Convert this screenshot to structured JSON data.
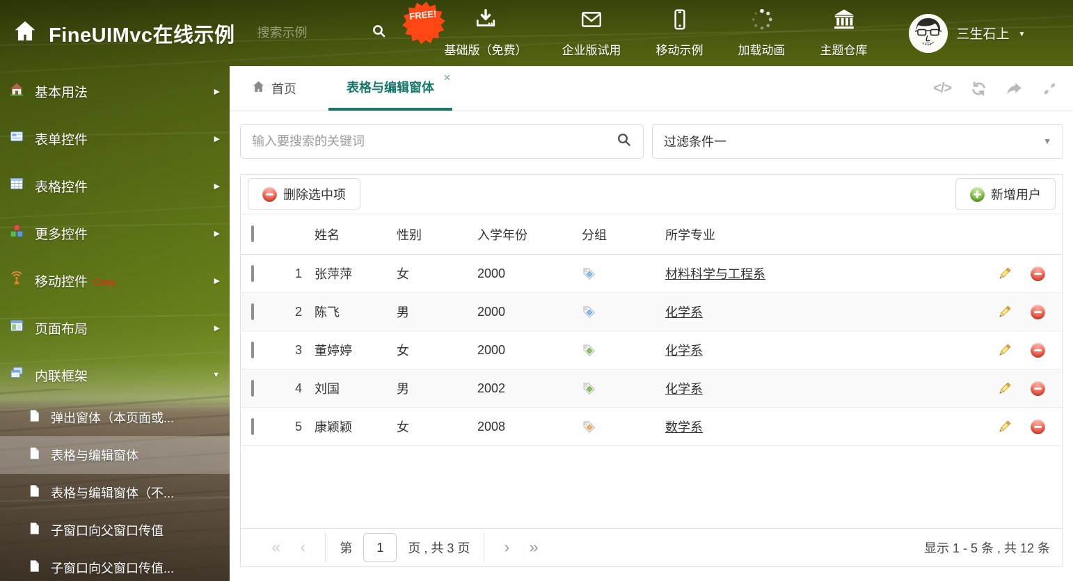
{
  "header": {
    "logo": "FineUIMvc在线示例",
    "search_placeholder": "搜索示例",
    "free_badge": "FREE!",
    "nav": [
      {
        "label": "基础版（免费）",
        "icon": "download-icon"
      },
      {
        "label": "企业版试用",
        "icon": "envelope-icon"
      },
      {
        "label": "移动示例",
        "icon": "phone-icon"
      },
      {
        "label": "加载动画",
        "icon": "spinner-icon"
      },
      {
        "label": "主题仓库",
        "icon": "bank-icon"
      }
    ],
    "user": {
      "name": "三生石上"
    }
  },
  "sidebar": {
    "items": [
      {
        "label": "基本用法",
        "icon": "home-icon"
      },
      {
        "label": "表单控件",
        "icon": "form-icon"
      },
      {
        "label": "表格控件",
        "icon": "table-icon"
      },
      {
        "label": "更多控件",
        "icon": "cubes-icon"
      },
      {
        "label": "移动控件",
        "badge": "Corp.",
        "icon": "antenna-icon"
      },
      {
        "label": "页面布局",
        "icon": "layout-icon"
      },
      {
        "label": "内联框架",
        "icon": "frames-icon",
        "expanded": true
      }
    ],
    "subitems": [
      {
        "label": "弹出窗体（本页面或...",
        "selected": false
      },
      {
        "label": "表格与编辑窗体",
        "selected": true
      },
      {
        "label": "表格与编辑窗体（不...",
        "selected": false
      },
      {
        "label": "子窗口向父窗口传值",
        "selected": false
      },
      {
        "label": "子窗口向父窗口传值...",
        "selected": false
      }
    ]
  },
  "tabs": [
    {
      "label": "首页",
      "active": false
    },
    {
      "label": "表格与编辑窗体",
      "active": true,
      "closable": true
    }
  ],
  "filters": {
    "search_placeholder": "输入要搜索的关键词",
    "filter_value": "过滤条件一"
  },
  "toolbar": {
    "delete_label": "删除选中项",
    "add_label": "新增用户"
  },
  "table": {
    "columns": {
      "name": "姓名",
      "gender": "性别",
      "year": "入学年份",
      "group": "分组",
      "major": "所学专业"
    },
    "rows": [
      {
        "num": "1",
        "name": "张萍萍",
        "gender": "女",
        "year": "2000",
        "tag": "blue",
        "major": "材料科学与工程系"
      },
      {
        "num": "2",
        "name": "陈飞",
        "gender": "男",
        "year": "2000",
        "tag": "blue",
        "major": "化学系"
      },
      {
        "num": "3",
        "name": "董婷婷",
        "gender": "女",
        "year": "2000",
        "tag": "green",
        "major": "化学系"
      },
      {
        "num": "4",
        "name": "刘国",
        "gender": "男",
        "year": "2002",
        "tag": "green",
        "major": "化学系"
      },
      {
        "num": "5",
        "name": "康颖颖",
        "gender": "女",
        "year": "2008",
        "tag": "orange",
        "major": "数学系"
      }
    ]
  },
  "pagination": {
    "page_prefix": "第",
    "current_page": "1",
    "page_suffix": "页 , 共 3 页",
    "summary": "显示 1 - 5 条 , 共 12 条"
  },
  "icons": {
    "caret_right": "▶",
    "caret_down": "▼",
    "user_caret": "▼",
    "select_caret": "▼",
    "close": "✕",
    "code": "</>",
    "pager_first": "«",
    "pager_prev": "‹",
    "pager_next": "›",
    "pager_last": "»"
  },
  "colors": {
    "accent_teal": "#15786b",
    "free_badge_orange": "#ff4713",
    "delete_red": "#ee6251",
    "add_green": "#7cc044",
    "tag_blue": "#85c1ee",
    "tag_green": "#8dc063",
    "tag_orange": "#f6b26e"
  }
}
